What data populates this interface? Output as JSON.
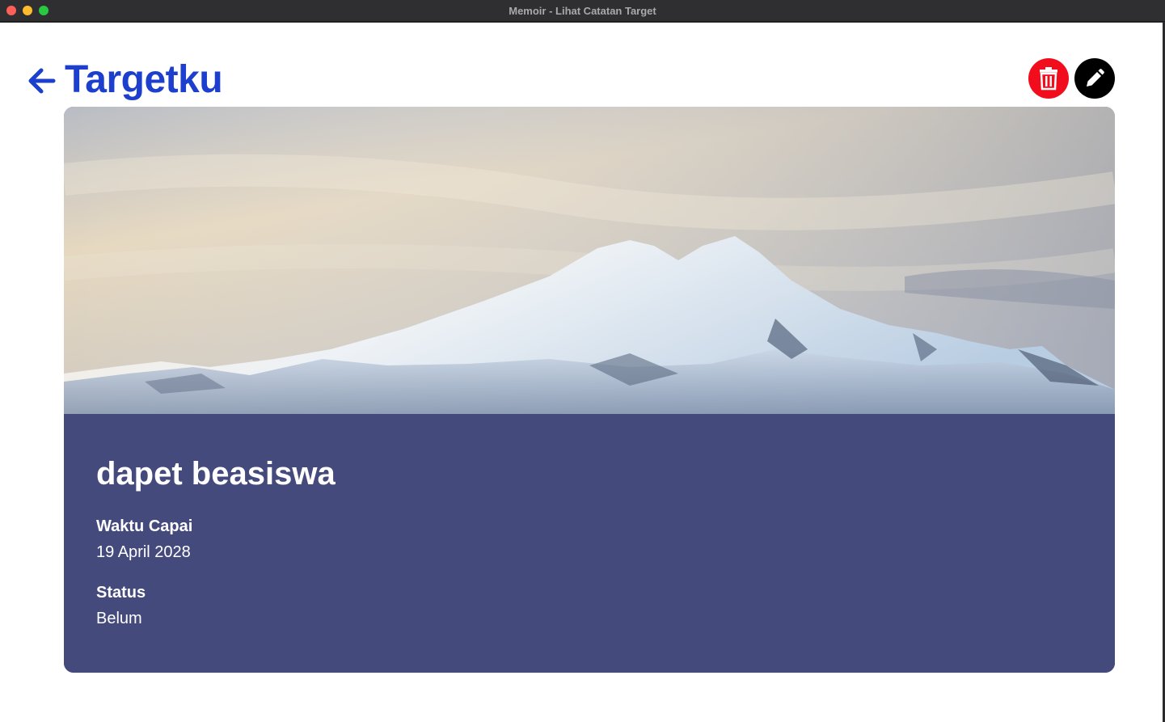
{
  "window": {
    "title": "Memoir - Lihat Catatan Target"
  },
  "header": {
    "title": "Targetku",
    "back_icon": "arrow-left-icon",
    "delete_icon": "trash-icon",
    "edit_icon": "pencil-icon"
  },
  "target": {
    "title": "dapet beasiswa",
    "image": "snow-capped-mountain",
    "fields": {
      "time_label": "Waktu Capai",
      "time_value": "19 April 2028",
      "status_label": "Status",
      "status_value": "Belum"
    }
  },
  "colors": {
    "accent": "#1c3fce",
    "delete": "#f20d1c",
    "edit": "#000000",
    "card": "#454a7d"
  }
}
